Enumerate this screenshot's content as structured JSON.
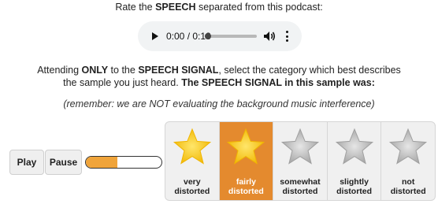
{
  "header": {
    "prefix": "Rate the ",
    "emphasis": "SPEECH",
    "suffix": " separated from this podcast:"
  },
  "audio_player": {
    "time": "0:00 / 0:18",
    "play_icon": "play-icon",
    "volume_icon": "volume-icon",
    "more_icon": "more-options-icon"
  },
  "instructions": {
    "p1": "Attending ",
    "p2": "ONLY",
    "p3": " to the ",
    "p4": "SPEECH SIGNAL",
    "p5": ", select the category which best describes the sample you just heard. ",
    "p6": "The SPEECH SIGNAL in this sample was:"
  },
  "reminder": "(remember: we are NOT evaluating the background music interference)",
  "controls": {
    "play_label": "Play",
    "pause_label": "Pause",
    "progress_fraction": 0.42
  },
  "rating_options": [
    {
      "line1": "very",
      "line2": "distorted",
      "star": "filled",
      "selected": false
    },
    {
      "line1": "fairly",
      "line2": "distorted",
      "star": "filled",
      "selected": true
    },
    {
      "line1": "somewhat",
      "line2": "distorted",
      "star": "empty",
      "selected": false
    },
    {
      "line1": "slightly",
      "line2": "distorted",
      "star": "empty",
      "selected": false
    },
    {
      "line1": "not",
      "line2": "distorted",
      "star": "empty",
      "selected": false
    }
  ],
  "colors": {
    "accent": "#e48a2e",
    "progress_fill": "#f0a43a",
    "star_gold_light": "#ffe66a",
    "star_gold_dark": "#f0b500",
    "star_grey_light": "#e6e6e6",
    "star_grey_dark": "#a0a0a0"
  }
}
